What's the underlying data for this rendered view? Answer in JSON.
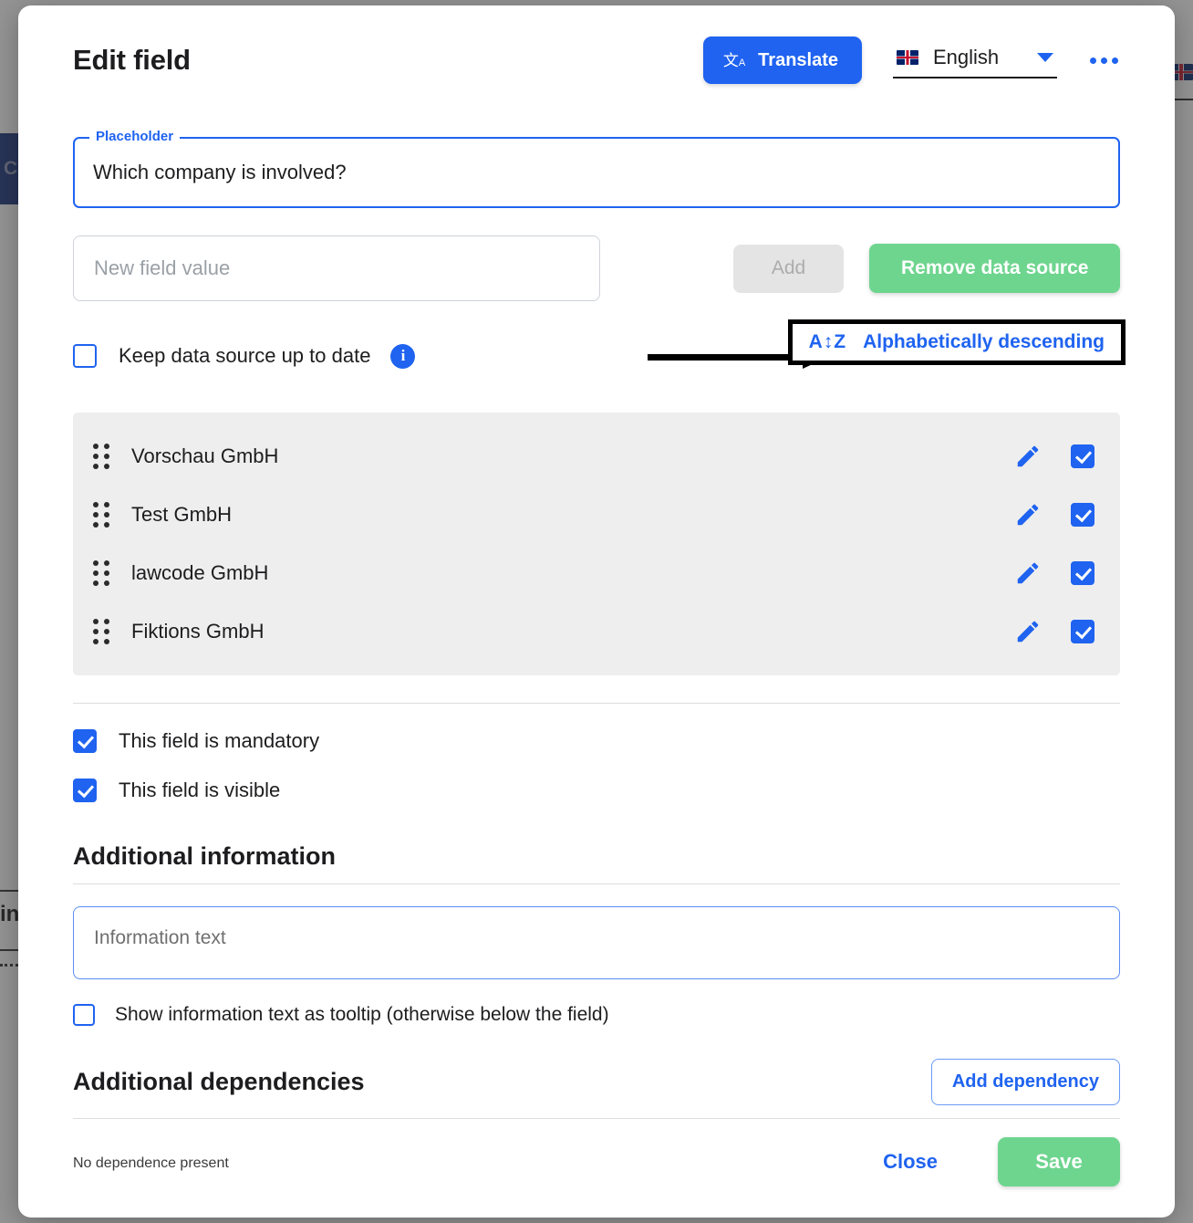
{
  "background": {
    "left_chip_text": "CR",
    "left_label_text": "in"
  },
  "dialog": {
    "title": "Edit field",
    "header": {
      "translate_label": "Translate",
      "translate_icon": "translate-icon",
      "language": "English",
      "language_flag": "uk-flag-icon",
      "more_icon": "ellipsis-icon"
    },
    "placeholder_field": {
      "legend": "Placeholder",
      "value": "Which company is involved?"
    },
    "new_value_field": {
      "placeholder": "New field value",
      "value": ""
    },
    "add_button": "Add",
    "remove_data_source_button": "Remove data source",
    "keep_up_to_date": {
      "label": "Keep data source up to date",
      "checked": false,
      "info_icon": "info-icon"
    },
    "sort_control": {
      "label": "Alphabetically descending",
      "icon": "az-sort-icon",
      "highlighted": true
    },
    "values": [
      {
        "label": "Vorschau GmbH",
        "checked": true
      },
      {
        "label": "Test GmbH",
        "checked": true
      },
      {
        "label": "lawcode GmbH",
        "checked": true
      },
      {
        "label": "Fiktions GmbH",
        "checked": true
      }
    ],
    "mandatory": {
      "label": "This field is mandatory",
      "checked": true
    },
    "visible": {
      "label": "This field is visible",
      "checked": true
    },
    "additional_information": {
      "heading": "Additional information",
      "info_placeholder": "Information text",
      "info_value": "",
      "tooltip_label": "Show information text as tooltip (otherwise below the field)",
      "tooltip_checked": false
    },
    "additional_dependencies": {
      "heading": "Additional dependencies",
      "add_button": "Add dependency",
      "empty_text": "No dependence present"
    },
    "footer": {
      "close_label": "Close",
      "save_label": "Save"
    }
  },
  "colors": {
    "primary_blue": "#1f63f0",
    "green": "#6ed58f",
    "list_bg": "#eeeeee",
    "disabled_grey": "#e4e4e4",
    "annotation": "#000000"
  }
}
